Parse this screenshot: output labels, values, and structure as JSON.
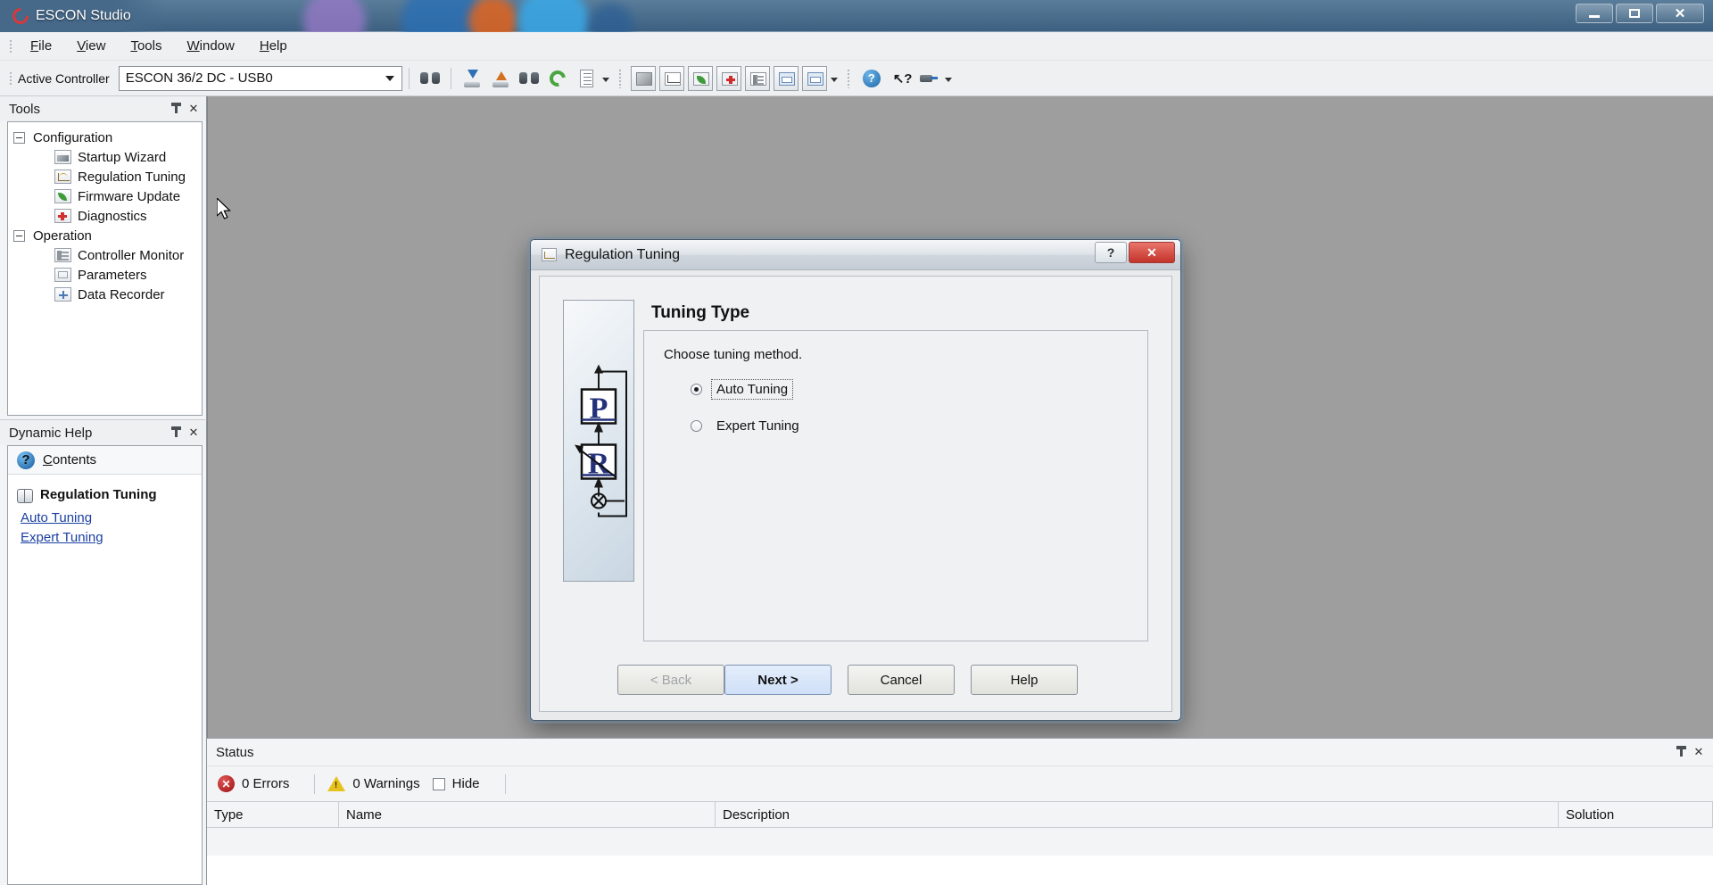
{
  "window": {
    "title": "ESCON Studio",
    "logo_icon": "escon-logo-icon",
    "minimize_label": "Minimize",
    "maximize_label": "Maximize",
    "close_label": "Close"
  },
  "menu": {
    "items": [
      {
        "label": "File",
        "mnemonic": "F"
      },
      {
        "label": "View",
        "mnemonic": "V"
      },
      {
        "label": "Tools",
        "mnemonic": "T"
      },
      {
        "label": "Window",
        "mnemonic": "W"
      },
      {
        "label": "Help",
        "mnemonic": "H"
      }
    ]
  },
  "toolbar": {
    "active_controller_label": "Active Controller",
    "controller_value": "ESCON 36/2 DC - USB0",
    "icons": [
      {
        "name": "search-binoculars-icon"
      },
      {
        "name": "download-to-device-icon"
      },
      {
        "name": "upload-from-device-icon"
      },
      {
        "name": "device-connect-icon"
      },
      {
        "name": "refresh-icon"
      },
      {
        "name": "document-list-icon"
      },
      {
        "name": "overflow-chevron-icon"
      },
      {
        "name": "startup-wizard-icon"
      },
      {
        "name": "regulation-tuning-icon"
      },
      {
        "name": "firmware-update-icon"
      },
      {
        "name": "diagnostics-icon"
      },
      {
        "name": "controller-monitor-icon"
      },
      {
        "name": "parameters-icon"
      },
      {
        "name": "data-recorder-icon"
      },
      {
        "name": "overflow-chevron-icon-2"
      },
      {
        "name": "help-circle-icon"
      },
      {
        "name": "context-help-arrow-icon"
      },
      {
        "name": "cable-wiring-icon"
      },
      {
        "name": "overflow-chevron-icon-3"
      }
    ]
  },
  "tools_panel": {
    "caption": "Tools",
    "pin_label": "Auto Hide",
    "close_label": "Close",
    "groups": [
      {
        "label": "Configuration",
        "items": [
          {
            "label": "Startup Wizard",
            "icon": "startup-wizard-icon"
          },
          {
            "label": "Regulation Tuning",
            "icon": "regulation-tuning-icon"
          },
          {
            "label": "Firmware Update",
            "icon": "firmware-update-icon"
          },
          {
            "label": "Diagnostics",
            "icon": "diagnostics-icon"
          }
        ]
      },
      {
        "label": "Operation",
        "items": [
          {
            "label": "Controller Monitor",
            "icon": "controller-monitor-icon"
          },
          {
            "label": "Parameters",
            "icon": "parameters-icon"
          },
          {
            "label": "Data Recorder",
            "icon": "data-recorder-icon"
          }
        ]
      }
    ]
  },
  "help_panel": {
    "caption": "Dynamic Help",
    "pin_label": "Auto Hide",
    "close_label": "Close",
    "contents_label": "Contents",
    "contents_mnemonic": "C",
    "topic_title": "Regulation Tuning",
    "links": [
      {
        "label": "Auto Tuning"
      },
      {
        "label": "Expert Tuning"
      }
    ]
  },
  "dialog": {
    "title": "Regulation Tuning",
    "help_button": "?",
    "close_button": "x",
    "heading": "Tuning Type",
    "instruction": "Choose tuning method.",
    "options": [
      {
        "label": "Auto Tuning",
        "selected": true,
        "focused": true
      },
      {
        "label": "Expert Tuning",
        "selected": false,
        "focused": false
      }
    ],
    "buttons": [
      {
        "label": "< Back",
        "state": "disabled"
      },
      {
        "label": "Next >",
        "state": "default"
      },
      {
        "label": "Cancel",
        "state": "normal"
      },
      {
        "label": "Help",
        "state": "normal"
      }
    ],
    "wizard_image": {
      "name": "control-loop-diagram",
      "block_top": "P",
      "block_bottom": "R"
    }
  },
  "status_pane": {
    "caption": "Status",
    "pin_label": "Auto Hide",
    "close_label": "Close",
    "errors_text": "0 Errors",
    "warnings_text": "0 Warnings",
    "hide_label": "Hide",
    "hide_checked": false,
    "columns": [
      "Type",
      "Name",
      "Description",
      "Solution"
    ],
    "rows": []
  },
  "colors": {
    "accent_blue": "#1a3fa0",
    "error_red": "#9c0f0f",
    "warning_yellow": "#e8c21c",
    "default_button": "#cfe0f7",
    "close_button": "#c3332a"
  }
}
